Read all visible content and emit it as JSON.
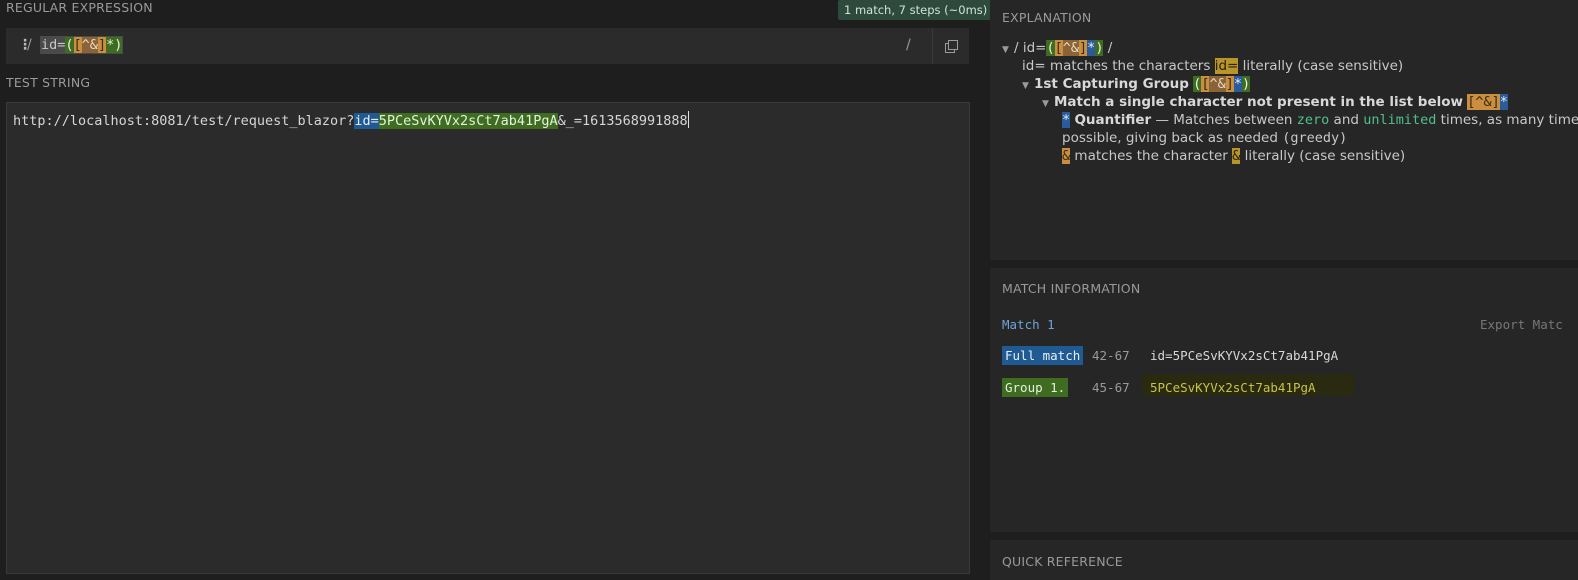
{
  "regex_section": {
    "label": "REGULAR EXPRESSION",
    "match_badge": "1 match, 7 steps (~0ms)",
    "delimiter_open": "/",
    "delimiter_close": "/",
    "flags_icon": "⋮",
    "pattern": {
      "lit": "id=",
      "open_paren": "(",
      "cls_open": "[",
      "cls_body": "^&",
      "cls_close": "]",
      "quant": "*",
      "close_paren": ")"
    }
  },
  "test_section": {
    "label": "TEST STRING",
    "prefix": "http://localhost:8081/test/request_blazor?",
    "match_lit": "id=",
    "match_group": "5PCeSvKYVx2sCt7ab41PgA",
    "suffix": "&_=1613568991888"
  },
  "explanation": {
    "title": "EXPLANATION",
    "root_open": "/ id=",
    "root_close": " /",
    "line1_lit": "id=",
    "line1_text": " matches the characters ",
    "line1_lit2": "id=",
    "line1_tail": " literally (case sensitive)",
    "group_title": "1st Capturing Group",
    "group_tokens": "([^&]*)",
    "class_title": "Match a single character not present in the list below",
    "class_token": "[^&]",
    "quant_token": "*",
    "quant_title": "Quantifier",
    "quant_text_a": " — Matches between ",
    "quant_zero": "zero",
    "quant_text_b": " and ",
    "quant_unlimited": "unlimited",
    "quant_text_c": " times, as many times as",
    "quant_line2": "possible, giving back as needed ",
    "quant_greedy": "(greedy)",
    "amp_token": "&",
    "amp_text": " matches the character ",
    "amp_token2": "&",
    "amp_tail": " literally (case sensitive)"
  },
  "match_info": {
    "title": "MATCH INFORMATION",
    "match_label": "Match 1",
    "export_label": "Export Matc",
    "rows": [
      {
        "label": "Full match",
        "range": "42-67",
        "value": "id=5PCeSvKYVx2sCt7ab41PgA"
      },
      {
        "label": "Group 1.",
        "range": "45-67",
        "value": "5PCeSvKYVx2sCt7ab41PgA"
      }
    ]
  },
  "quick_reference": {
    "title": "QUICK REFERENCE"
  },
  "colors": {
    "full_match": "#1f5a93",
    "group": "#3e6d22",
    "badge": "#2e4a3d",
    "group_text": "#c8c24a"
  }
}
